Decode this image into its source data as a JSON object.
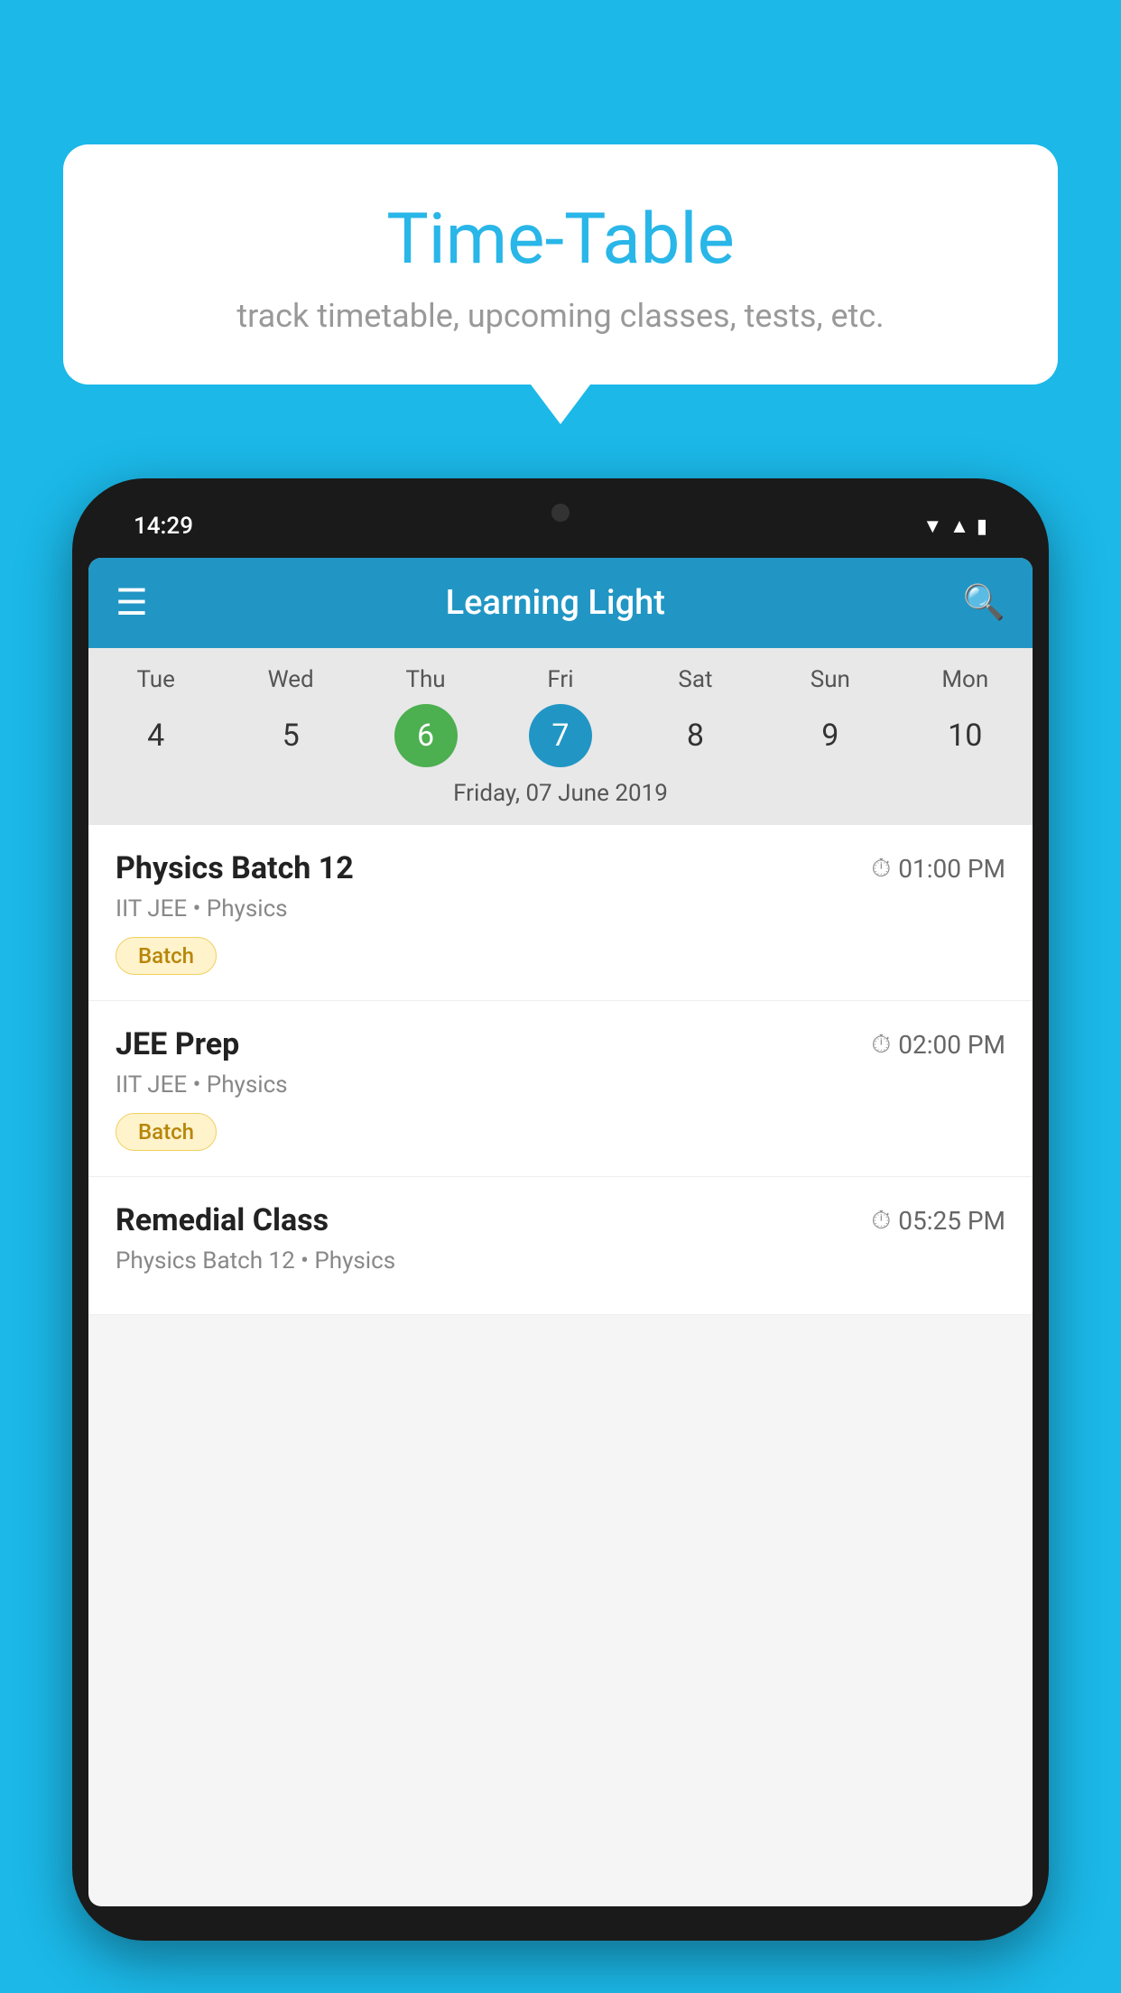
{
  "background": {
    "color": "#1bb8e8"
  },
  "speech_bubble": {
    "title": "Time-Table",
    "subtitle": "track timetable, upcoming classes, tests, etc."
  },
  "phone": {
    "status_bar": {
      "time": "14:29",
      "icons": [
        "wifi",
        "signal",
        "battery"
      ]
    },
    "app_bar": {
      "title": "Learning Light",
      "hamburger_label": "☰",
      "search_label": "🔍"
    },
    "calendar": {
      "day_names": [
        "Tue",
        "Wed",
        "Thu",
        "Fri",
        "Sat",
        "Sun",
        "Mon"
      ],
      "day_numbers": [
        "4",
        "5",
        "6",
        "7",
        "8",
        "9",
        "10"
      ],
      "today_index": 2,
      "selected_index": 3,
      "date_label": "Friday, 07 June 2019"
    },
    "schedule_items": [
      {
        "title": "Physics Batch 12",
        "time": "01:00 PM",
        "subtitle": "IIT JEE • Physics",
        "badge": "Batch"
      },
      {
        "title": "JEE Prep",
        "time": "02:00 PM",
        "subtitle": "IIT JEE • Physics",
        "badge": "Batch"
      },
      {
        "title": "Remedial Class",
        "time": "05:25 PM",
        "subtitle": "Physics Batch 12 • Physics",
        "badge": null
      }
    ]
  }
}
